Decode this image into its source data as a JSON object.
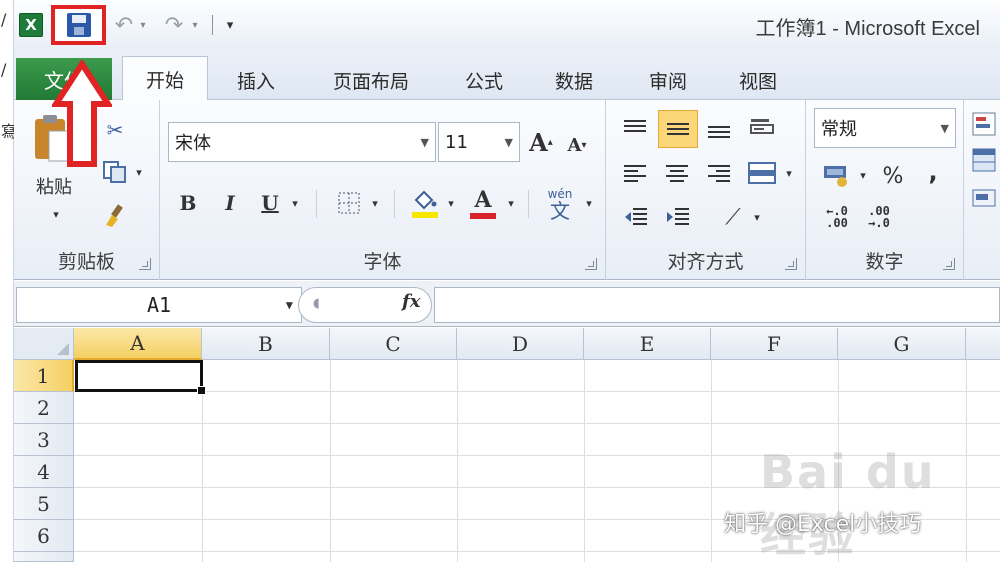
{
  "window": {
    "title": "工作簿1 - Microsoft Excel"
  },
  "quick_access": {
    "app_icon": "excel-logo",
    "save_icon": "save-icon",
    "undo_icon": "undo-icon",
    "redo_icon": "redo-icon",
    "customize_icon": "customize-qat-icon",
    "highlight_color": "#e02424"
  },
  "tabs": [
    {
      "label": "文件"
    },
    {
      "label": "开始"
    },
    {
      "label": "插入"
    },
    {
      "label": "页面布局"
    },
    {
      "label": "公式"
    },
    {
      "label": "数据"
    },
    {
      "label": "审阅"
    },
    {
      "label": "视图"
    }
  ],
  "ribbon": {
    "clipboard": {
      "label": "剪贴板",
      "paste_label": "粘贴"
    },
    "font": {
      "label": "字体",
      "font_name": "宋体",
      "font_size": "11",
      "bold": "B",
      "italic": "I",
      "underline": "U",
      "font_color_glyph": "A",
      "grow_glyph": "A",
      "shrink_glyph": "A",
      "phonetic_glyph": "wén"
    },
    "alignment": {
      "label": "对齐方式"
    },
    "number": {
      "label": "数字",
      "format": "常规",
      "percent": "%",
      "comma": ","
    }
  },
  "formula_bar": {
    "name_box": "A1",
    "fx": "fx"
  },
  "sheet": {
    "columns": [
      "A",
      "B",
      "C",
      "D",
      "E",
      "F",
      "G"
    ],
    "rows": [
      "1",
      "2",
      "3",
      "4",
      "5",
      "6"
    ],
    "active_cell": "A1"
  },
  "watermarks": {
    "baidu": "Bai du 经验",
    "zhihu": "知乎 @Excel小技巧"
  },
  "colors": {
    "file_tab": "#2e8a41",
    "selection_header": "#f5cf63",
    "font_color_bar": "#d8232a",
    "fill_color_bar": "#f7e600"
  }
}
